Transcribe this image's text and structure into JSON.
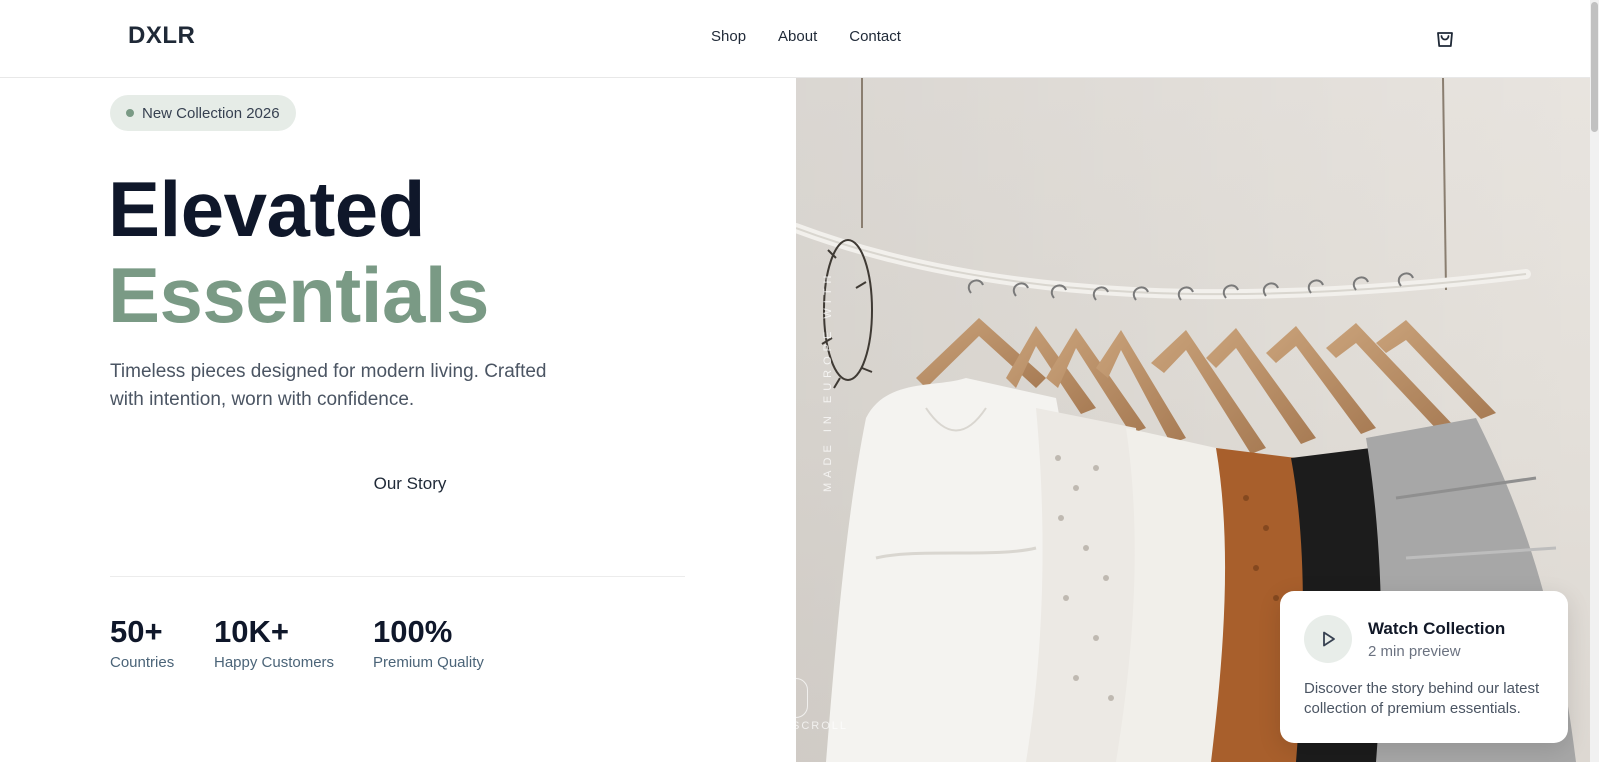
{
  "header": {
    "logo": "DXLR",
    "nav": [
      "Shop",
      "About",
      "Contact"
    ],
    "cart_icon": "shopping-bag-icon"
  },
  "hero": {
    "badge": "New Collection 2026",
    "title_line1": "Elevated",
    "title_line2": "Essentials",
    "subtitle": "Timeless pieces designed for modern living. Crafted with intention, worn with confidence.",
    "cta_secondary": "Our Story",
    "stats": [
      {
        "value": "50+",
        "label": "Countries"
      },
      {
        "value": "10K+",
        "label": "Happy Customers"
      },
      {
        "value": "100%",
        "label": "Premium Quality"
      }
    ],
    "image_vertical_text": "MADE IN EUROPE WITH",
    "scroll_label": "SCROLL"
  },
  "card": {
    "title": "Watch Collection",
    "subtitle": "2 min preview",
    "description": "Discover the story behind our latest collection of premium essentials.",
    "icon": "play-icon"
  },
  "colors": {
    "accent": "#7a9a85",
    "dark": "#0f172a",
    "badge_bg": "#e6ece7"
  }
}
